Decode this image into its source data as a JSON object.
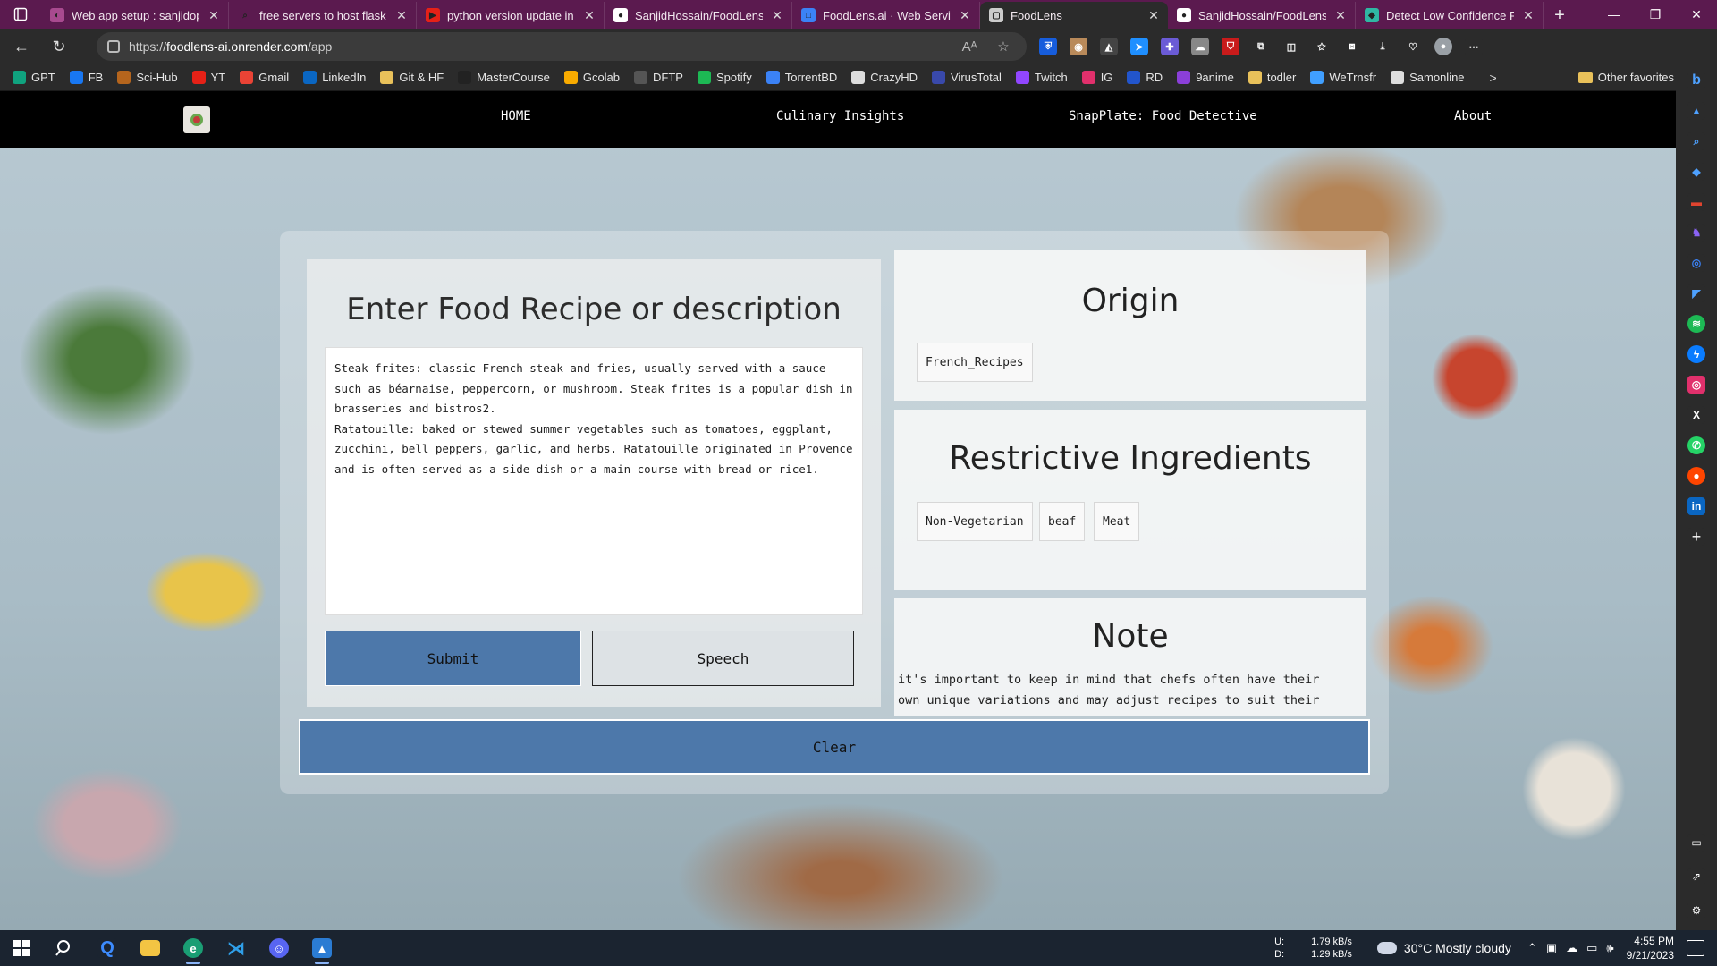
{
  "browser": {
    "tabs": [
      {
        "title": "Web app setup : sanjidop",
        "fav_color": "#a84a8f",
        "fav_glyph": "◐",
        "active": false
      },
      {
        "title": "free servers to host flask w",
        "fav_color": "#5b1a4f",
        "fav_glyph": "⌕",
        "active": false
      },
      {
        "title": "python version update in r",
        "fav_color": "#e62117",
        "fav_glyph": "▶",
        "active": false
      },
      {
        "title": "SanjidHossain/FoodLens.ai",
        "fav_color": "#ffffff",
        "fav_glyph": "●",
        "active": false
      },
      {
        "title": "FoodLens.ai · Web Service",
        "fav_color": "#3b82f6",
        "fav_glyph": "□",
        "active": false
      },
      {
        "title": "FoodLens",
        "fav_color": "#cccccc",
        "fav_glyph": "▢",
        "active": true
      },
      {
        "title": "SanjidHossain/FoodLens.ai",
        "fav_color": "#ffffff",
        "fav_glyph": "●",
        "active": false
      },
      {
        "title": "Detect Low Confidence Re",
        "fav_color": "#2fb7a3",
        "fav_glyph": "◆",
        "active": false
      }
    ],
    "new_tab_glyph": "+",
    "window_controls": {
      "minimize": "—",
      "restore": "❐",
      "close": "✕"
    },
    "nav": {
      "back": "←",
      "refresh": "↻"
    },
    "url_prefix": "https://",
    "url_host": "foodlens-ai.onrender.com",
    "url_path": "/app",
    "omni_icons": {
      "read_aloud": "Aᴬ",
      "favorite": "☆"
    },
    "extensions": [
      {
        "name": "bitwarden-icon",
        "color": "#175ddc",
        "glyph": "⛨"
      },
      {
        "name": "cookie-icon",
        "color": "#b98a5a",
        "glyph": "◉"
      },
      {
        "name": "extension-dark-icon",
        "color": "#444444",
        "glyph": "◭"
      },
      {
        "name": "arrow-extension-icon",
        "color": "#1f8fff",
        "glyph": "➤"
      },
      {
        "name": "plus-extension-icon",
        "color": "#6b5bd6",
        "glyph": "✚"
      },
      {
        "name": "cloud-extension-icon",
        "color": "#888888",
        "glyph": "☁"
      },
      {
        "name": "ublock-icon",
        "color": "#c91b1b",
        "glyph": "⛉"
      },
      {
        "name": "puzzle-icon",
        "color": "#2b2b2b",
        "glyph": "⧉"
      },
      {
        "name": "split-screen-icon",
        "color": "#2b2b2b",
        "glyph": "◫"
      },
      {
        "name": "favorites-icon",
        "color": "#2b2b2b",
        "glyph": "✩"
      },
      {
        "name": "collections-icon",
        "color": "#2b2b2b",
        "glyph": "⧈"
      },
      {
        "name": "download-icon",
        "color": "#2b2b2b",
        "glyph": "⤓"
      },
      {
        "name": "performance-icon",
        "color": "#2b2b2b",
        "glyph": "♡"
      },
      {
        "name": "profile-avatar-icon",
        "color": "#9aa0a6",
        "glyph": "●"
      },
      {
        "name": "more-menu-icon",
        "color": "#2b2b2b",
        "glyph": "⋯"
      }
    ]
  },
  "favorites": [
    {
      "label": "GPT",
      "color": "#10a37f"
    },
    {
      "label": "FB",
      "color": "#1877f2"
    },
    {
      "label": "Sci-Hub",
      "color": "#b5651d"
    },
    {
      "label": "YT",
      "color": "#e62117"
    },
    {
      "label": "Gmail",
      "color": "#ea4335"
    },
    {
      "label": "LinkedIn",
      "color": "#0a66c2"
    },
    {
      "label": "Git & HF",
      "color": "#e9c15a"
    },
    {
      "label": "MasterCourse",
      "color": "#222222"
    },
    {
      "label": "Gcolab",
      "color": "#f9ab00"
    },
    {
      "label": "DFTP",
      "color": "#555555"
    },
    {
      "label": "Spotify",
      "color": "#1db954"
    },
    {
      "label": "TorrentBD",
      "color": "#3b82f6"
    },
    {
      "label": "CrazyHD",
      "color": "#dddddd"
    },
    {
      "label": "VirusTotal",
      "color": "#3949ab"
    },
    {
      "label": "Twitch",
      "color": "#9146ff"
    },
    {
      "label": "IG",
      "color": "#e1306c"
    },
    {
      "label": "RD",
      "color": "#2255cc"
    },
    {
      "label": "9anime",
      "color": "#8b3fd9"
    },
    {
      "label": "todler",
      "color": "#e9c15a"
    },
    {
      "label": "WeTrnsfr",
      "color": "#409fff"
    },
    {
      "label": "Samonline",
      "color": "#dddddd"
    }
  ],
  "favorites_more": ">",
  "favorites_other": "Other favorites",
  "site": {
    "nav_links": [
      "HOME",
      "Culinary Insights",
      "SnapPlate: Food Detective",
      "About"
    ],
    "input_title": "Enter Food Recipe or description",
    "recipe_text": "Steak frites: classic French steak and fries, usually served with a sauce\nsuch as béarnaise, peppercorn, or mushroom. Steak frites is a popular dish in\nbrasseries and bistros2.\nRatatouille: baked or stewed summer vegetables such as tomatoes, eggplant,\nzucchini, bell peppers, garlic, and herbs. Ratatouille originated in Provence\nand is often served as a side dish or a main course with bread or rice1.",
    "submit_label": "Submit",
    "speech_label": "Speech",
    "clear_label": "Clear",
    "origin_title": "Origin",
    "origin_tags": [
      "French_Recipes"
    ],
    "restrict_title": "Restrictive Ingredients",
    "restrict_tags": [
      "Non-Vegetarian",
      "beaf",
      "Meat"
    ],
    "note_title": "Note",
    "note_text": "it's important to keep in mind that chefs often have their\nown unique variations and may adjust recipes to suit their specialty."
  },
  "taskbar": {
    "net_up_label": "U:",
    "net_down_label": "D:",
    "net_up": "1.79 kB/s",
    "net_down": "1.29 kB/s",
    "weather": "30°C  Mostly cloudy",
    "time": "4:55 PM",
    "date": "9/21/2023"
  }
}
